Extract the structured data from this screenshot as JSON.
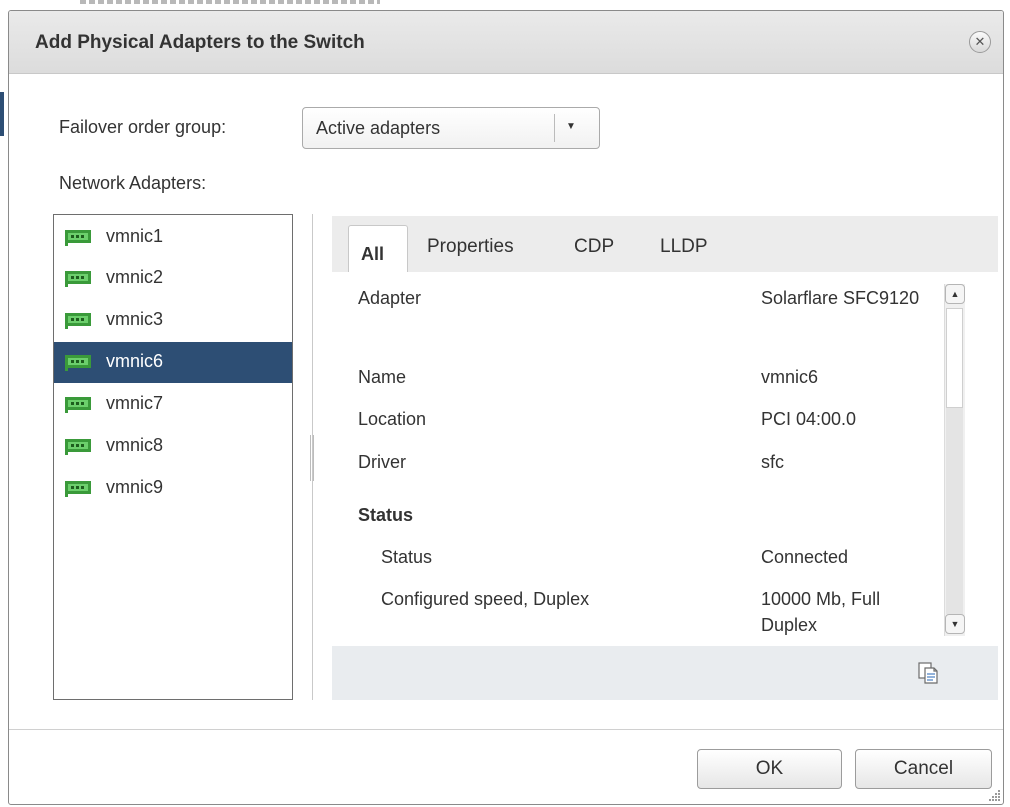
{
  "dialog": {
    "title": "Add Physical Adapters to the Switch",
    "close_icon": "close-icon"
  },
  "failover": {
    "label": "Failover order group:",
    "selected": "Active adapters"
  },
  "adapters": {
    "label": "Network Adapters:",
    "items": [
      {
        "name": "vmnic1",
        "selected": false
      },
      {
        "name": "vmnic2",
        "selected": false
      },
      {
        "name": "vmnic3",
        "selected": false
      },
      {
        "name": "vmnic6",
        "selected": true
      },
      {
        "name": "vmnic7",
        "selected": false
      },
      {
        "name": "vmnic8",
        "selected": false
      },
      {
        "name": "vmnic9",
        "selected": false
      }
    ],
    "icon": "network-card-icon"
  },
  "details": {
    "tabs": [
      "All",
      "Properties",
      "CDP",
      "LLDP"
    ],
    "active_tab": "All",
    "rows": [
      {
        "key": "Adapter",
        "value": "Solarflare SFC9120"
      },
      {
        "key": "Name",
        "value": "vmnic6"
      },
      {
        "key": "Location",
        "value": "PCI 04:00.0"
      },
      {
        "key": "Driver",
        "value": "sfc"
      }
    ],
    "section": "Status",
    "status_rows": [
      {
        "key": "Status",
        "value": "Connected"
      },
      {
        "key": "Configured speed, Duplex",
        "value": "10000 Mb, Full Duplex"
      }
    ],
    "copy_icon": "copy-icon"
  },
  "buttons": {
    "ok": "OK",
    "cancel": "Cancel"
  },
  "colors": {
    "selection": "#2d4e74",
    "title_bar": "#e3e3e3",
    "nic_green": "#3a9a3a"
  }
}
